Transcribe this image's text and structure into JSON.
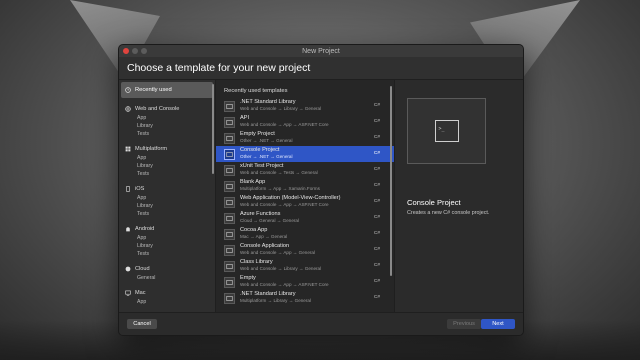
{
  "window": {
    "title": "New Project"
  },
  "heading": "Choose a template for your new project",
  "sidebar": {
    "recent_label": "Recently used",
    "groups": [
      {
        "label": "Web and Console",
        "icon": "globe-icon",
        "items": [
          "App",
          "Library",
          "Tests"
        ]
      },
      {
        "label": "Multiplatform",
        "icon": "multiplatform-icon",
        "items": [
          "App",
          "Library",
          "Tests"
        ]
      },
      {
        "label": "iOS",
        "icon": "phone-icon",
        "items": [
          "App",
          "Library",
          "Tests"
        ]
      },
      {
        "label": "Android",
        "icon": "android-icon",
        "items": [
          "App",
          "Library",
          "Tests"
        ]
      },
      {
        "label": "Cloud",
        "icon": "cloud-icon",
        "items": [
          "General"
        ]
      },
      {
        "label": "Mac",
        "icon": "mac-icon",
        "items": [
          "App"
        ]
      }
    ]
  },
  "list": {
    "header": "Recently used templates",
    "rows": [
      {
        "name": ".NET Standard Library",
        "sub": "Web and Console → Library → General",
        "lang": "C#"
      },
      {
        "name": "API",
        "sub": "Web and Console → App → ASP.NET Core",
        "lang": "C#"
      },
      {
        "name": "Empty Project",
        "sub": "Other → .NET → General",
        "lang": "C#"
      },
      {
        "name": "Console Project",
        "sub": "Other → .NET → General",
        "lang": "C#",
        "selected": true
      },
      {
        "name": "xUnit Test Project",
        "sub": "Web and Console → Tests → General",
        "lang": "C#"
      },
      {
        "name": "Blank App",
        "sub": "Multiplatform → App → Xamarin.Forms",
        "lang": "C#"
      },
      {
        "name": "Web Application (Model-View-Controller)",
        "sub": "Web and Console → App → ASP.NET Core",
        "lang": "C#"
      },
      {
        "name": "Azure Functions",
        "sub": "Cloud → General → General",
        "lang": "C#"
      },
      {
        "name": "Cocoa App",
        "sub": "Mac → App → General",
        "lang": "C#"
      },
      {
        "name": "Console Application",
        "sub": "Web and Console → App → General",
        "lang": "C#"
      },
      {
        "name": "Class Library",
        "sub": "Web and Console → Library → General",
        "lang": "C#"
      },
      {
        "name": "Empty",
        "sub": "Web and Console → App → ASP.NET Core",
        "lang": "C#"
      },
      {
        "name": ".NET Standard Library",
        "sub": "Multiplatform → Library → General",
        "lang": "C#"
      }
    ]
  },
  "detail": {
    "title": "Console Project",
    "description": "Creates a new C# console project."
  },
  "footer": {
    "cancel": "Cancel",
    "previous": "Previous",
    "next": "Next"
  },
  "colors": {
    "accent": "#2f56c6",
    "close": "#e0443e",
    "window_bg": "#2b2b2b"
  }
}
